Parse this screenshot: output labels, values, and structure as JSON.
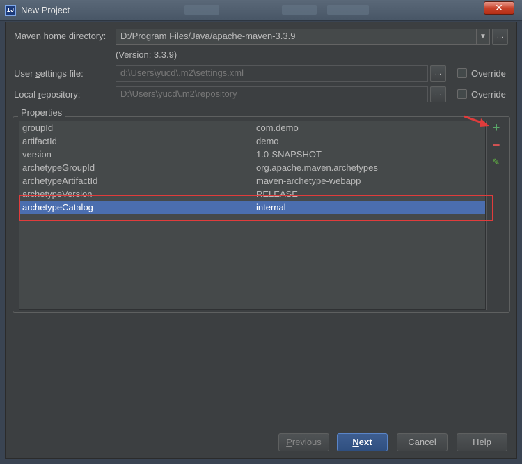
{
  "window": {
    "title": "New Project",
    "app_icon_text": "IJ",
    "close_glyph": "✕"
  },
  "form": {
    "maven_home": {
      "label_pre": "Maven ",
      "label_u": "h",
      "label_post": "ome directory:",
      "value": "D:/Program Files/Java/apache-maven-3.3.9",
      "version_note": "(Version: 3.3.9)"
    },
    "user_settings": {
      "label_pre": "User ",
      "label_u": "s",
      "label_post": "ettings file:",
      "value": "d:\\Users\\yucd\\.m2\\settings.xml",
      "override_label": "Override"
    },
    "local_repo": {
      "label_pre": "Local ",
      "label_u": "r",
      "label_post": "epository:",
      "value": "D:\\Users\\yucd\\.m2\\repository",
      "override_label": "Override"
    },
    "browse_label": "..."
  },
  "properties": {
    "title": "Properties",
    "rows": [
      {
        "key": "groupId",
        "value": "com.demo"
      },
      {
        "key": "artifactId",
        "value": "demo"
      },
      {
        "key": "version",
        "value": "1.0-SNAPSHOT"
      },
      {
        "key": "archetypeGroupId",
        "value": "org.apache.maven.archetypes"
      },
      {
        "key": "archetypeArtifactId",
        "value": "maven-archetype-webapp"
      },
      {
        "key": "archetypeVersion",
        "value": "RELEASE"
      },
      {
        "key": "archetypeCatalog",
        "value": "internal"
      }
    ],
    "toolbar": {
      "add": "+",
      "remove": "−",
      "edit": "✎"
    },
    "colors": {
      "add": "#59a869",
      "remove": "#d25252",
      "edit": "#62b543",
      "selection": "#4b6eaf",
      "annotation": "#e03c3c"
    }
  },
  "buttons": {
    "previous_u": "P",
    "previous_rest": "revious",
    "next_u": "N",
    "next_rest": "ext",
    "cancel": "Cancel",
    "help": "Help"
  }
}
